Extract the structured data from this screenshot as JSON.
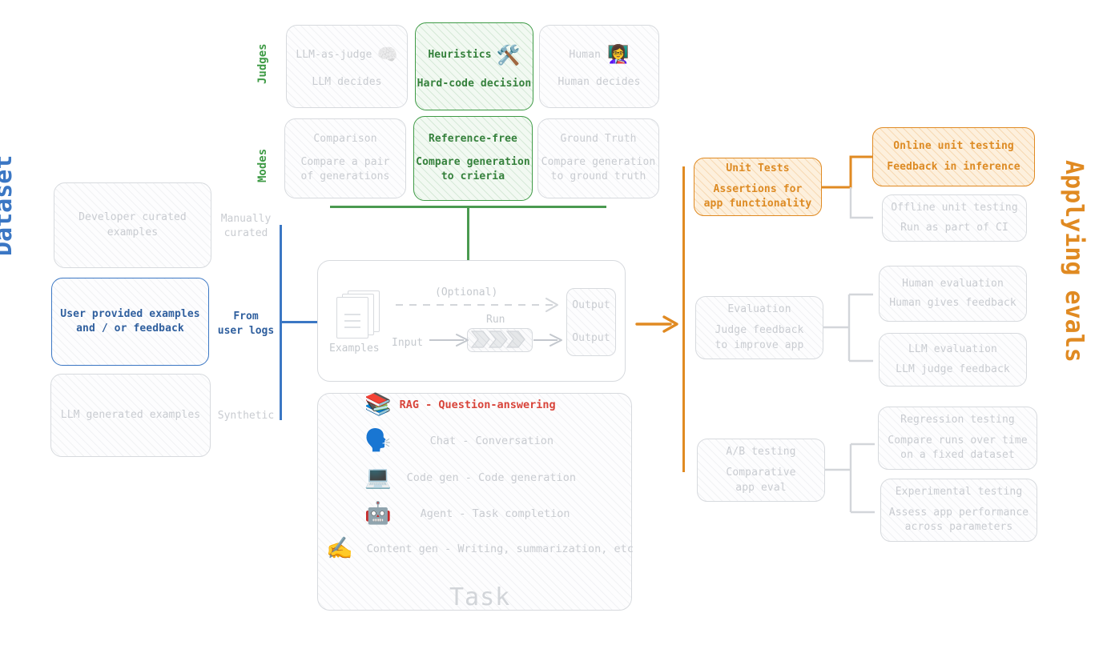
{
  "sections": {
    "dataset_title": "Dataset",
    "applying_title": "Applying evals",
    "judges_title": "Judges",
    "modes_title": "Modes"
  },
  "dataset": {
    "items": [
      {
        "box": "Developer curated\nexamples",
        "side": "Manually\ncurated",
        "state": "muted"
      },
      {
        "box": "User provided examples\nand / or feedback",
        "side": "From\nuser logs",
        "state": "blue"
      },
      {
        "box": "LLM generated examples",
        "side": "Synthetic",
        "state": "muted"
      }
    ]
  },
  "judges": {
    "cards": [
      {
        "title": "LLM-as-judge",
        "sub": "LLM decides",
        "emoji": "🧠",
        "state": "muted"
      },
      {
        "title": "Heuristics",
        "sub": "Hard-code decision",
        "emoji": "🛠️",
        "state": "green"
      },
      {
        "title": "Human",
        "sub": "Human decides",
        "emoji": "👩‍🏫",
        "state": "muted"
      }
    ]
  },
  "modes": {
    "cards": [
      {
        "title": "Comparison",
        "sub": "Compare a pair\nof generations",
        "state": "muted"
      },
      {
        "title": "Reference-free",
        "sub": "Compare generation\nto crieria",
        "state": "green"
      },
      {
        "title": "Ground Truth",
        "sub": "Compare generation\nto ground truth",
        "state": "muted"
      }
    ]
  },
  "pipeline": {
    "examples_label": "Examples",
    "input_label": "Input",
    "run_label": "Run",
    "optional_label": "(Optional)",
    "output_top_label": "Output",
    "output_bottom_label": "Output"
  },
  "task": {
    "heading": "Task",
    "rows": [
      {
        "emoji": "📚",
        "label": "RAG - Question-answering",
        "state": "highlight"
      },
      {
        "emoji": "🗣️",
        "label": "Chat - Conversation",
        "state": "muted"
      },
      {
        "emoji": "💻",
        "label": "Code gen - Code generation",
        "state": "muted"
      },
      {
        "emoji": "🤖",
        "label": "Agent - Task completion",
        "state": "muted"
      },
      {
        "emoji": "✍️",
        "label": "Content gen - Writing, summarization, etc",
        "state": "muted"
      }
    ]
  },
  "applying": {
    "groups": [
      {
        "parent": {
          "title": "Unit Tests",
          "sub": "Assertions for\napp functionality",
          "state": "orange"
        },
        "children": [
          {
            "title": "Online unit testing",
            "sub": "Feedback in inference",
            "state": "orange"
          },
          {
            "title": "Offline unit testing",
            "sub": "Run as part of CI",
            "state": "muted"
          }
        ]
      },
      {
        "parent": {
          "title": "Evaluation",
          "sub": "Judge feedback\nto improve app",
          "state": "muted"
        },
        "children": [
          {
            "title": "Human evaluation",
            "sub": "Human gives feedback",
            "state": "muted"
          },
          {
            "title": "LLM evaluation",
            "sub": "LLM judge feedback",
            "state": "muted"
          }
        ]
      },
      {
        "parent": {
          "title": "A/B testing",
          "sub": "Comparative\napp eval",
          "state": "muted"
        },
        "children": [
          {
            "title": "Regression testing",
            "sub": "Compare runs over time\non a fixed dataset",
            "state": "muted"
          },
          {
            "title": "Experimental testing",
            "sub": "Assess app performance\nacross parameters",
            "state": "muted"
          }
        ]
      }
    ]
  },
  "colors": {
    "blue": "#3b77c4",
    "green": "#3f9b46",
    "orange": "#e08a22",
    "muted_text": "#c9ccd1",
    "muted_border": "#d7dade",
    "red": "#d8443a"
  }
}
